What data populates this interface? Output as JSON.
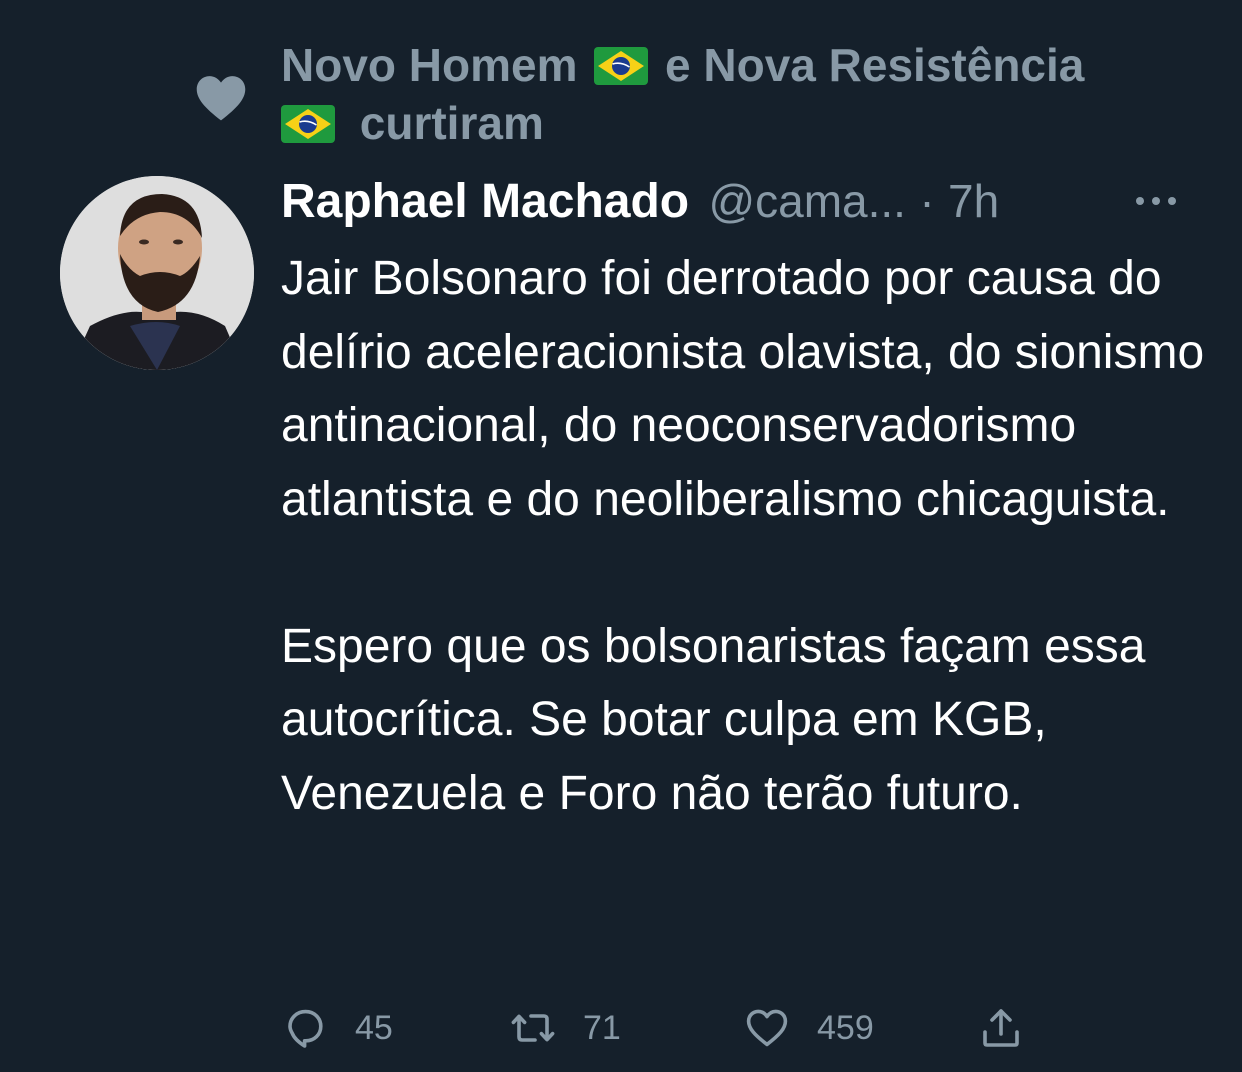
{
  "social_context": {
    "user1": "Novo Homem",
    "connector": "e Nova Resistência",
    "action": "curtiram",
    "icon": "heart-icon"
  },
  "tweet": {
    "author_name": "Raphael Machado",
    "handle": "@cama...",
    "separator": "·",
    "time": "7h",
    "paragraphs": [
      "Jair Bolsonaro foi derrotado por causa do delírio aceleracionista olavista, do sionismo antinacional, do neoconservadorismo atlantista e do neoliberalismo chicaguista.",
      "Espero que os bolsonaristas façam essa autocrítica. Se botar culpa em KGB, Venezuela e Foro não terão futuro."
    ]
  },
  "actions": {
    "replies": "45",
    "retweets": "71",
    "likes": "459"
  },
  "colors": {
    "background": "#15202b",
    "primary_text": "#ffffff",
    "secondary_text": "#8899a6"
  }
}
